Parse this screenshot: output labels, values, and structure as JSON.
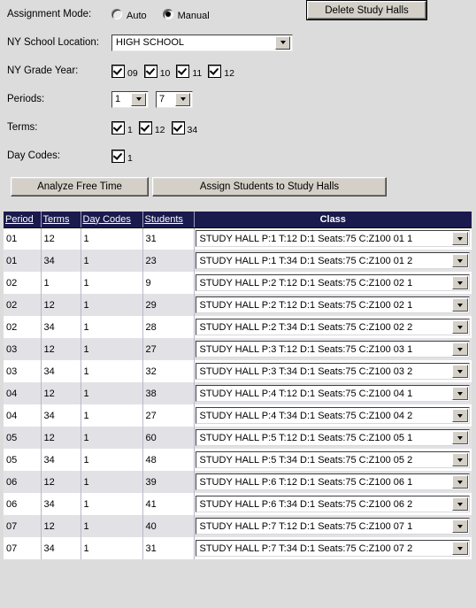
{
  "form": {
    "assignment_mode": {
      "label": "Assignment Mode:",
      "options": [
        {
          "label": "Auto",
          "selected": false
        },
        {
          "label": "Manual",
          "selected": true
        }
      ]
    },
    "school_location": {
      "label": "NY School Location:",
      "value": "HIGH SCHOOL"
    },
    "grade_year": {
      "label": "NY Grade Year:",
      "items": [
        {
          "label": "09",
          "checked": true
        },
        {
          "label": "10",
          "checked": true
        },
        {
          "label": "11",
          "checked": true
        },
        {
          "label": "12",
          "checked": true
        }
      ]
    },
    "periods": {
      "label": "Periods:",
      "from": "1",
      "to": "7"
    },
    "terms": {
      "label": "Terms:",
      "items": [
        {
          "label": "1",
          "checked": true
        },
        {
          "label": "12",
          "checked": true
        },
        {
          "label": "34",
          "checked": true
        }
      ]
    },
    "day_codes": {
      "label": "Day Codes:",
      "items": [
        {
          "label": "1",
          "checked": true
        }
      ]
    }
  },
  "buttons": {
    "delete_study_halls": "Delete Study Halls",
    "analyze_free_time": "Analyze Free Time",
    "assign_students": "Assign Students to Study Halls"
  },
  "table": {
    "headers": [
      "Period",
      "Terms",
      "Day  Codes",
      "Students",
      "Class"
    ],
    "rows": [
      {
        "period": "01",
        "terms": "12",
        "day_codes": "1",
        "students": "31",
        "class": "STUDY HALL P:1 T:12 D:1 Seats:75 C:Z100 01 1"
      },
      {
        "period": "01",
        "terms": "34",
        "day_codes": "1",
        "students": "23",
        "class": "STUDY HALL P:1 T:34 D:1 Seats:75 C:Z100 01 2"
      },
      {
        "period": "02",
        "terms": "1",
        "day_codes": "1",
        "students": "9",
        "class": "STUDY HALL P:2 T:12 D:1 Seats:75 C:Z100 02 1"
      },
      {
        "period": "02",
        "terms": "12",
        "day_codes": "1",
        "students": "29",
        "class": "STUDY HALL P:2 T:12 D:1 Seats:75 C:Z100 02 1"
      },
      {
        "period": "02",
        "terms": "34",
        "day_codes": "1",
        "students": "28",
        "class": "STUDY HALL P:2 T:34 D:1 Seats:75 C:Z100 02 2"
      },
      {
        "period": "03",
        "terms": "12",
        "day_codes": "1",
        "students": "27",
        "class": "STUDY HALL P:3 T:12 D:1 Seats:75 C:Z100 03 1"
      },
      {
        "period": "03",
        "terms": "34",
        "day_codes": "1",
        "students": "32",
        "class": "STUDY HALL P:3 T:34 D:1 Seats:75 C:Z100 03 2"
      },
      {
        "period": "04",
        "terms": "12",
        "day_codes": "1",
        "students": "38",
        "class": "STUDY HALL P:4 T:12 D:1 Seats:75 C:Z100 04 1"
      },
      {
        "period": "04",
        "terms": "34",
        "day_codes": "1",
        "students": "27",
        "class": "STUDY HALL P:4 T:34 D:1 Seats:75 C:Z100 04 2"
      },
      {
        "period": "05",
        "terms": "12",
        "day_codes": "1",
        "students": "60",
        "class": "STUDY HALL P:5 T:12 D:1 Seats:75 C:Z100 05 1"
      },
      {
        "period": "05",
        "terms": "34",
        "day_codes": "1",
        "students": "48",
        "class": "STUDY HALL P:5 T:34 D:1 Seats:75 C:Z100 05 2"
      },
      {
        "period": "06",
        "terms": "12",
        "day_codes": "1",
        "students": "39",
        "class": "STUDY HALL P:6 T:12 D:1 Seats:75 C:Z100 06 1"
      },
      {
        "period": "06",
        "terms": "34",
        "day_codes": "1",
        "students": "41",
        "class": "STUDY HALL P:6 T:34 D:1 Seats:75 C:Z100 06 2"
      },
      {
        "period": "07",
        "terms": "12",
        "day_codes": "1",
        "students": "40",
        "class": "STUDY HALL P:7 T:12 D:1 Seats:75 C:Z100 07 1"
      },
      {
        "period": "07",
        "terms": "34",
        "day_codes": "1",
        "students": "31",
        "class": "STUDY HALL P:7 T:34 D:1 Seats:75 C:Z100 07 2"
      }
    ]
  },
  "colors": {
    "page_background": "#dcdcdc",
    "header_background": "#1a1a4e",
    "row_alt": "#e2e2e6",
    "button_face": "#d4d0c8"
  }
}
